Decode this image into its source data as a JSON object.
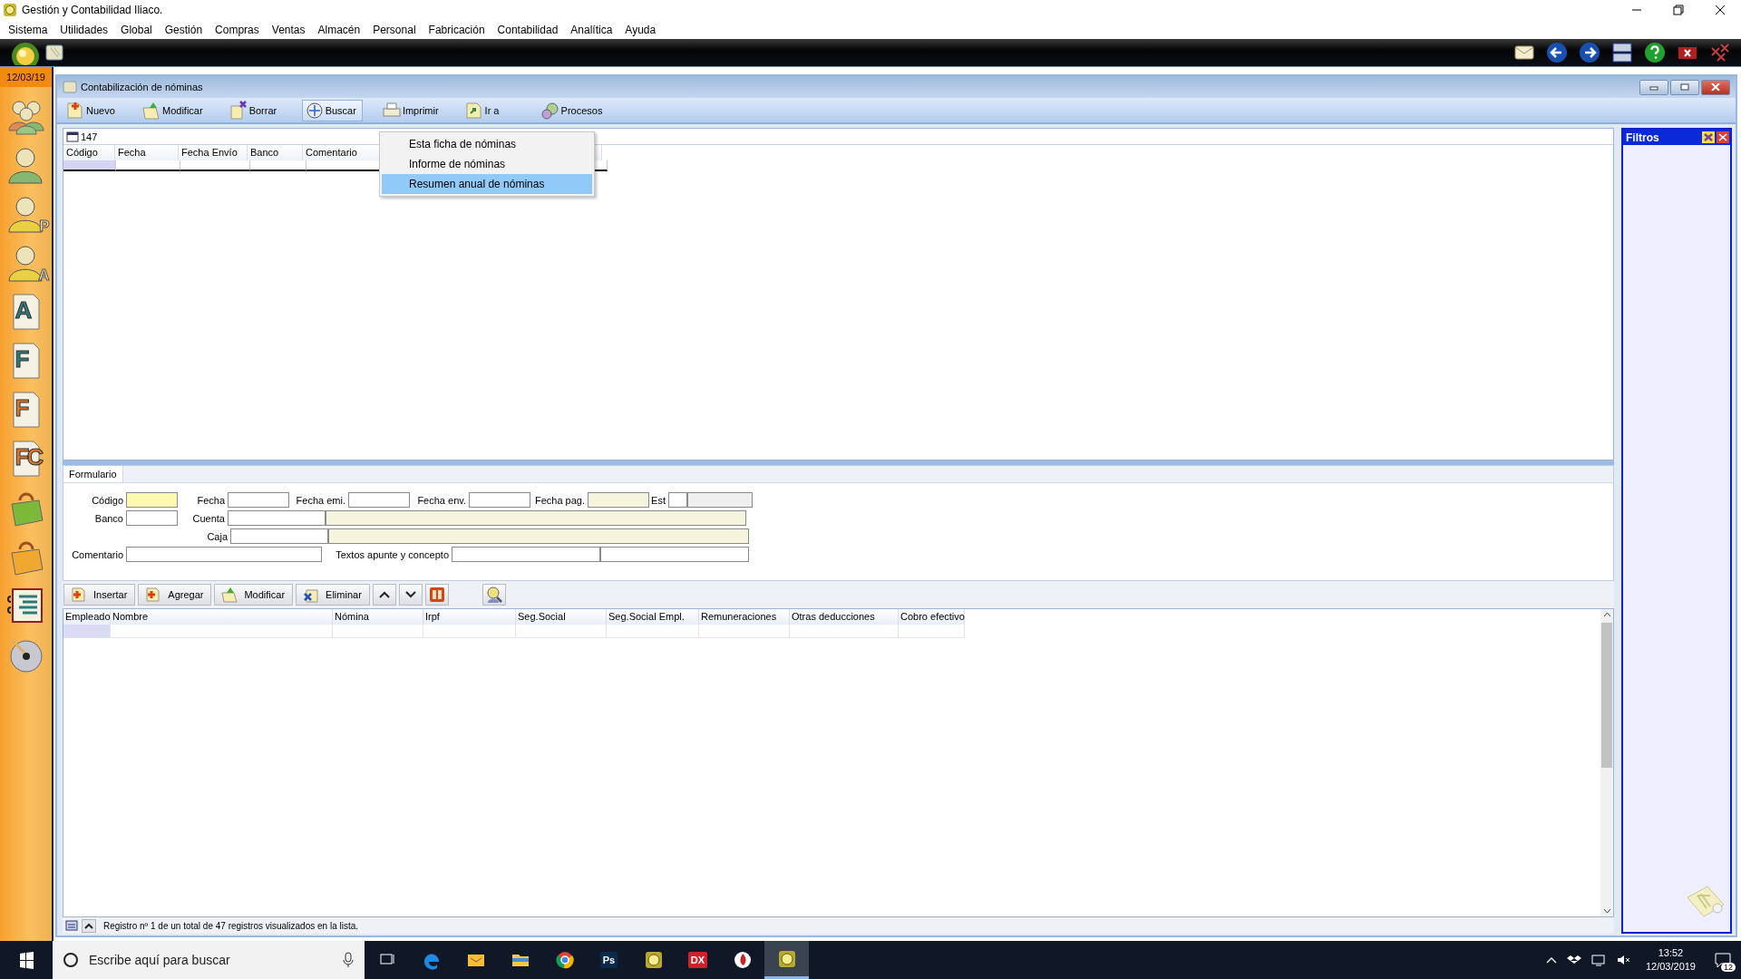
{
  "app_title": "Gestión y Contabilidad Iliaco.",
  "menu": [
    "Sistema",
    "Utilidades",
    "Global",
    "Gestión",
    "Compras",
    "Ventas",
    "Almacén",
    "Personal",
    "Fabricación",
    "Contabilidad",
    "Analítica",
    "Ayuda"
  ],
  "date": "12/03/19",
  "sidebar": [
    {
      "kind": "people"
    },
    {
      "kind": "person"
    },
    {
      "kind": "person",
      "letter": "P"
    },
    {
      "kind": "person",
      "letter": "A"
    },
    {
      "kind": "document",
      "letter": "A",
      "color": "#2e7a78"
    },
    {
      "kind": "document",
      "letter": "F",
      "color": "#2e7a78"
    },
    {
      "kind": "document",
      "letter": "F",
      "color": "#d9782a"
    },
    {
      "kind": "document",
      "letter": "FC",
      "color": "#d9782a"
    },
    {
      "kind": "bag",
      "color": "#7cb83a"
    },
    {
      "kind": "bag",
      "color": "#f0a830"
    },
    {
      "kind": "ledger"
    },
    {
      "kind": "disc"
    }
  ],
  "window": {
    "title": "Contabilización de nóminas",
    "toolbar": [
      {
        "label": "Nuevo",
        "highlighted": false
      },
      {
        "label": "Modificar",
        "highlighted": false
      },
      {
        "label": "Borrar",
        "highlighted": false
      },
      {
        "label": "Buscar",
        "highlighted": true
      },
      {
        "label": "Imprimir",
        "highlighted": false
      },
      {
        "label": "Ir a",
        "highlighted": false
      },
      {
        "label": "Procesos",
        "highlighted": false
      }
    ],
    "search": {
      "value": "147"
    },
    "list_columns": [
      "Código",
      "Fecha",
      "Fecha Envío",
      "Banco",
      "Comentario"
    ],
    "print_menu": [
      {
        "label": "Esta ficha de nóminas",
        "selected": false
      },
      {
        "label": "Informe de nóminas",
        "selected": false
      },
      {
        "label": "Resumen anual de nóminas",
        "selected": true
      }
    ],
    "filters": {
      "title": "Filtros"
    },
    "form": {
      "tab": "Formulario",
      "rows": [
        [
          {
            "label": "Código"
          },
          {
            "kind": "required"
          },
          {
            "label": "Fecha"
          },
          {
            "kind": "normal"
          },
          {
            "label": "Fecha emi."
          },
          {
            "kind": "normal"
          },
          {
            "label": "Fecha env."
          },
          {
            "kind": "normal"
          },
          {
            "label": "Fecha pag."
          },
          {
            "kind": "readonly"
          },
          {
            "label": "Est"
          },
          {
            "kind": "normal"
          },
          {
            "kind": "locked"
          }
        ],
        [
          {
            "label": "Banco"
          },
          {
            "kind": "normal"
          },
          {
            "label": "Cuenta"
          },
          {
            "kind": "normal"
          },
          {
            "kind": "readonly"
          }
        ],
        [
          {
            "kind": "empty"
          },
          {
            "kind": "empty"
          },
          {
            "label": "Caja"
          },
          {
            "kind": "normal"
          },
          {
            "kind": "readonly"
          }
        ],
        [
          {
            "label": "Comentario"
          },
          {
            "kind": "normal"
          },
          {
            "kind": "empty"
          },
          {
            "kind": "empty"
          },
          {
            "kind": "empty"
          },
          {
            "kind": "empty"
          },
          {
            "label": "Textos apunte y concepto"
          },
          {
            "kind": "normal"
          },
          {
            "kind": "normal"
          }
        ]
      ]
    },
    "line_toolbar": [
      {
        "label": "Insertar"
      },
      {
        "label": "Agregar"
      },
      {
        "label": "Modificar"
      },
      {
        "label": "Eliminar"
      }
    ],
    "grid_columns": [
      "Empleado",
      "Nombre",
      "Nómina",
      "Irpf",
      "Seg.Social",
      "Seg.Social Empl.",
      "Remuneraciones",
      "Otras deducciones",
      "Cobro efectivo"
    ],
    "status": "Registro nº 1 de un total de 47 registros visualizados en la lista."
  },
  "taskbar": {
    "search": {
      "placeholder": "Escribe aquí para buscar"
    },
    "apps": [
      {
        "kind": "taskview"
      },
      {
        "kind": "edge"
      },
      {
        "kind": "mailfolder"
      },
      {
        "kind": "explorer"
      },
      {
        "kind": "chrome"
      },
      {
        "kind": "tile",
        "label": "Ps",
        "color": "#0a2a4a"
      },
      {
        "kind": "appicon"
      },
      {
        "kind": "tile",
        "label": "DX",
        "color": "#d0202a"
      },
      {
        "kind": "flame"
      },
      {
        "kind": "appicon",
        "active": true
      }
    ],
    "time": "13:52",
    "date": "12/03/2019",
    "notifications": "12"
  }
}
